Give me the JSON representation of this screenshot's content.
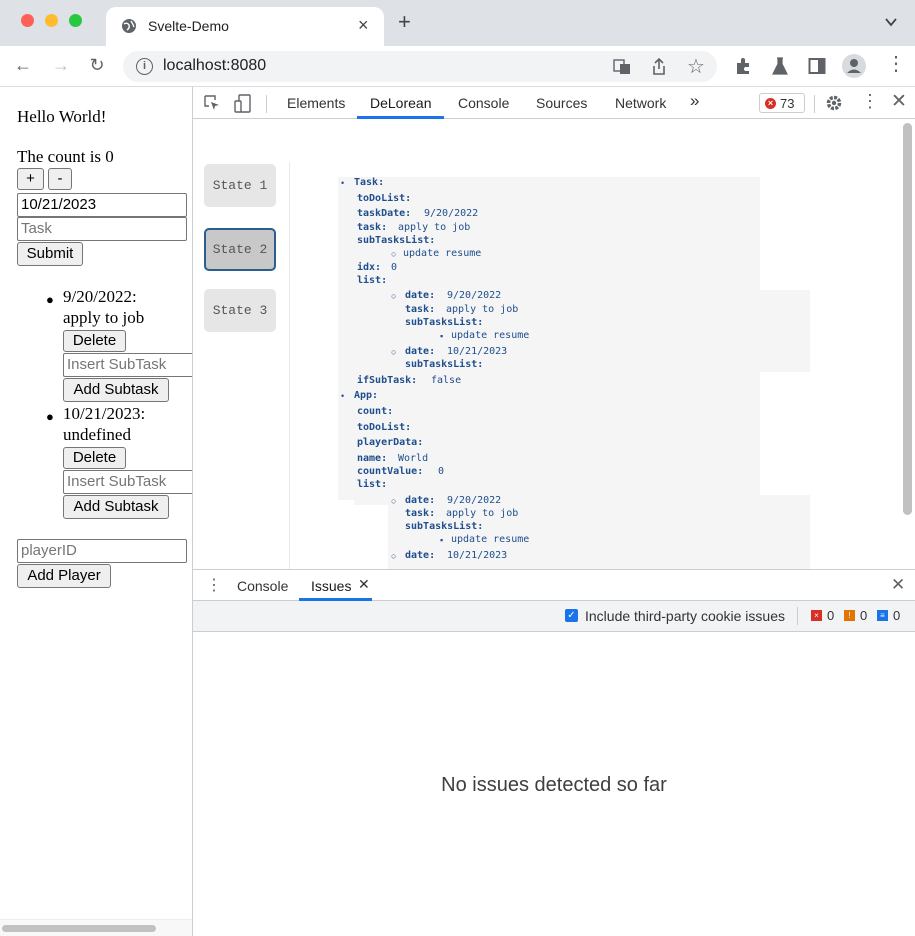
{
  "browser": {
    "tab_title": "Svelte-Demo",
    "url": "localhost:8080"
  },
  "app": {
    "greeting": "Hello World!",
    "count_text": "The count is 0",
    "increment_label": "+",
    "decrement_label": "-",
    "date_value": "10/21/2023",
    "task_placeholder": "Task",
    "submit_label": "Submit",
    "todos": [
      {
        "line1": "9/20/2022:",
        "line2": "apply to job",
        "delete_label": "Delete",
        "subtask_placeholder": "Insert SubTask",
        "add_subtask_label": "Add Subtask"
      },
      {
        "line1": "10/21/2023:",
        "line2": "undefined",
        "delete_label": "Delete",
        "subtask_placeholder": "Insert SubTask",
        "add_subtask_label": "Add Subtask"
      }
    ],
    "player_placeholder": "playerID",
    "add_player_label": "Add Player"
  },
  "devtools": {
    "tabs": [
      "Elements",
      "DeLorean",
      "Console",
      "Sources",
      "Network"
    ],
    "more_tabs": "»",
    "error_count": "73",
    "states": [
      "State 1",
      "State 2",
      "State 3"
    ],
    "tree": {
      "task": {
        "label": "Task:",
        "todolist": "toDoList:",
        "taskdate_key": "taskDate:",
        "taskdate_val": "9/20/2022",
        "task_key": "task:",
        "task_val": "apply to job",
        "subtasks_key": "subTasksList:",
        "subtask_item": "update resume",
        "idx_key": "idx:",
        "idx_val": "0",
        "list_key": "list:",
        "ifsub_key": "ifSubTask:",
        "ifsub_val": "false"
      },
      "list": [
        {
          "date_key": "date:",
          "date_val": "9/20/2022",
          "task_key": "task:",
          "task_val": "apply to job",
          "subtasks_key": "subTasksList:",
          "subtask_item": "update resume"
        },
        {
          "date_key": "date:",
          "date_val": "10/21/2023",
          "subtasks_key": "subTasksList:"
        }
      ],
      "app": {
        "label": "App:",
        "count_key": "count:",
        "todolist": "toDoList:",
        "playerdata": "playerData:",
        "name_key": "name:",
        "name_val": "World",
        "countvalue_key": "countValue:",
        "countvalue_val": "0",
        "list_key": "list:"
      }
    },
    "drawer": {
      "tabs": [
        "Console",
        "Issues"
      ],
      "third_party_label": "Include third-party cookie issues",
      "errors": "0",
      "warnings": "0",
      "infos": "0",
      "empty_message": "No issues detected so far"
    }
  },
  "colors": {
    "accent": "#1a73e8",
    "error": "#d93025",
    "warning": "#e37400",
    "tree_text": "#1f4e8c"
  }
}
